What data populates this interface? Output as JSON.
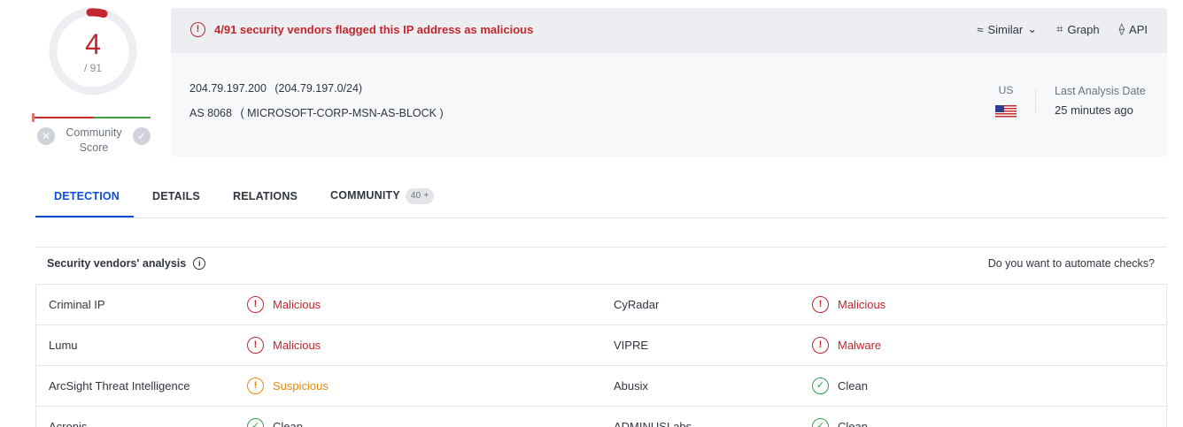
{
  "score": {
    "detections": "4",
    "total": "/ 91"
  },
  "community": {
    "label": "Community\nScore"
  },
  "alert": {
    "text": "4/91 security vendors flagged this IP address as malicious"
  },
  "actions": [
    {
      "label": "Similar",
      "icon": "similar-icon"
    },
    {
      "label": "Graph",
      "icon": "graph-icon"
    },
    {
      "label": "API",
      "icon": "api-icon"
    }
  ],
  "ip": {
    "address": "204.79.197.200",
    "range": "(204.79.197.0/24)",
    "asn": "AS 8068",
    "owner": "( MICROSOFT-CORP-MSN-AS-BLOCK )"
  },
  "country": {
    "code": "US"
  },
  "analysis": {
    "label": "Last Analysis Date",
    "value": "25 minutes ago"
  },
  "tabs": [
    {
      "label": "DETECTION",
      "active": true
    },
    {
      "label": "DETAILS"
    },
    {
      "label": "RELATIONS"
    },
    {
      "label": "COMMUNITY",
      "badge": "40 +"
    }
  ],
  "vendors_section": {
    "title": "Security vendors' analysis",
    "automate": "Do you want to automate checks?"
  },
  "vendors": [
    {
      "left": {
        "name": "Criminal IP",
        "result": "Malicious",
        "status": "malicious"
      },
      "right": {
        "name": "CyRadar",
        "result": "Malicious",
        "status": "malicious"
      }
    },
    {
      "left": {
        "name": "Lumu",
        "result": "Malicious",
        "status": "malicious"
      },
      "right": {
        "name": "VIPRE",
        "result": "Malware",
        "status": "malicious"
      }
    },
    {
      "left": {
        "name": "ArcSight Threat Intelligence",
        "result": "Suspicious",
        "status": "suspicious"
      },
      "right": {
        "name": "Abusix",
        "result": "Clean",
        "status": "clean"
      }
    },
    {
      "left": {
        "name": "Acronis",
        "result": "Clean",
        "status": "clean"
      },
      "right": {
        "name": "ADMINUSLabs",
        "result": "Clean",
        "status": "clean"
      }
    }
  ],
  "colors": {
    "malicious": "#c1272d",
    "suspicious": "#e8890c",
    "clean": "#2e9e48",
    "accent": "#0b4dda"
  }
}
